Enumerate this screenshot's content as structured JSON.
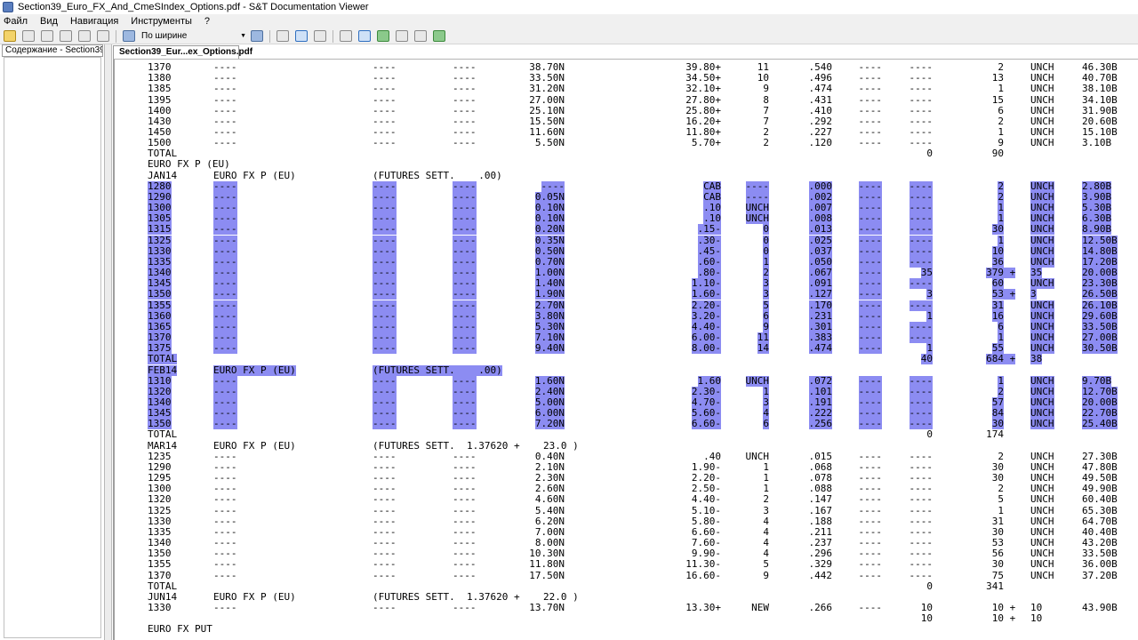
{
  "window": {
    "title": "Section39_Euro_FX_And_CmeSIndex_Options.pdf - S&T Documentation Viewer"
  },
  "menu": [
    "Файл",
    "Вид",
    "Навигация",
    "Инструменты",
    "?"
  ],
  "toolbar": {
    "zoom_value": "По ширине"
  },
  "left_panel": {
    "tab_label": "Содержание - Section39_Eu"
  },
  "document_tab": {
    "label": "Section39_Eur...ex_Options.pdf"
  },
  "table": {
    "rows": [
      [
        "1370",
        "----",
        "----",
        "----",
        "38.70N",
        "39.80+",
        "11",
        ".540",
        "----",
        "----",
        "2",
        "UNCH",
        "46.30B"
      ],
      [
        "1380",
        "----",
        "----",
        "----",
        "33.50N",
        "34.50+",
        "10",
        ".496",
        "----",
        "----",
        "13",
        "UNCH",
        "40.70B"
      ],
      [
        "1385",
        "----",
        "----",
        "----",
        "31.20N",
        "32.10+",
        "9",
        ".474",
        "----",
        "----",
        "1",
        "UNCH",
        "38.10B"
      ],
      [
        "1395",
        "----",
        "----",
        "----",
        "27.00N",
        "27.80+",
        "8",
        ".431",
        "----",
        "----",
        "15",
        "UNCH",
        "34.10B"
      ],
      [
        "1400",
        "----",
        "----",
        "----",
        "25.10N",
        "25.80+",
        "7",
        ".410",
        "----",
        "----",
        "6",
        "UNCH",
        "31.90B"
      ],
      [
        "1430",
        "----",
        "----",
        "----",
        "15.50N",
        "16.20+",
        "7",
        ".292",
        "----",
        "----",
        "2",
        "UNCH",
        "20.60B"
      ],
      [
        "1450",
        "----",
        "----",
        "----",
        "11.60N",
        "11.80+",
        "2",
        ".227",
        "----",
        "----",
        "1",
        "UNCH",
        "15.10B"
      ],
      [
        "1500",
        "----",
        "----",
        "----",
        "5.50N",
        "5.70+",
        "2",
        ".120",
        "----",
        "----",
        "9",
        "UNCH",
        "3.10B"
      ],
      [
        "TOTAL",
        "",
        "",
        "",
        "",
        "",
        "",
        "",
        "",
        "0",
        "90",
        "",
        ""
      ],
      [
        "EURO FX P (EU)",
        "",
        "",
        "",
        "",
        "",
        "",
        "",
        "",
        "",
        "",
        "",
        ""
      ],
      [
        "JAN14",
        "EURO FX P (EU)",
        "(FUTURES SETT.    .00)",
        "",
        "",
        "",
        "",
        "",
        "",
        "",
        "",
        "",
        ""
      ],
      [
        "1280",
        "----",
        "----",
        "----",
        "----",
        "CAB",
        "----",
        ".000",
        "----",
        "----",
        "2",
        "UNCH",
        "2.80B"
      ],
      [
        "1290",
        "----",
        "----",
        "----",
        "0.05N",
        "CAB",
        "----",
        ".002",
        "----",
        "----",
        "2",
        "UNCH",
        "3.90B"
      ],
      [
        "1300",
        "----",
        "----",
        "----",
        "0.10N",
        ".10",
        "UNCH",
        ".007",
        "----",
        "----",
        "1",
        "UNCH",
        "5.30B"
      ],
      [
        "1305",
        "----",
        "----",
        "----",
        "0.10N",
        ".10",
        "UNCH",
        ".008",
        "----",
        "----",
        "1",
        "UNCH",
        "6.30B"
      ],
      [
        "1315",
        "----",
        "----",
        "----",
        "0.20N",
        ".15-",
        "0",
        ".013",
        "----",
        "----",
        "30",
        "UNCH",
        "8.90B"
      ],
      [
        "1325",
        "----",
        "----",
        "----",
        "0.35N",
        ".30-",
        "0",
        ".025",
        "----",
        "----",
        "1",
        "UNCH",
        "12.50B"
      ],
      [
        "1330",
        "----",
        "----",
        "----",
        "0.50N",
        ".45-",
        "0",
        ".037",
        "----",
        "----",
        "10",
        "UNCH",
        "14.80B"
      ],
      [
        "1335",
        "----",
        "----",
        "----",
        "0.70N",
        ".60-",
        "1",
        ".050",
        "----",
        "----",
        "36",
        "UNCH",
        "17.20B"
      ],
      [
        "1340",
        "----",
        "----",
        "----",
        "1.00N",
        ".80-",
        "2",
        ".067",
        "----",
        "35",
        "379 +",
        "35",
        "20.00B"
      ],
      [
        "1345",
        "----",
        "----",
        "----",
        "1.40N",
        "1.10-",
        "3",
        ".091",
        "----",
        "----",
        "60",
        "UNCH",
        "23.30B"
      ],
      [
        "1350",
        "----",
        "----",
        "----",
        "1.90N",
        "1.60-",
        "3",
        ".127",
        "----",
        "3",
        "53 +",
        "3",
        "26.50B"
      ],
      [
        "1355",
        "----",
        "----",
        "----",
        "2.70N",
        "2.20-",
        "5",
        ".170",
        "----",
        "----",
        "31",
        "UNCH",
        "26.10B"
      ],
      [
        "1360",
        "----",
        "----",
        "----",
        "3.80N",
        "3.20-",
        "6",
        ".231",
        "----",
        "1",
        "16",
        "UNCH",
        "29.60B"
      ],
      [
        "1365",
        "----",
        "----",
        "----",
        "5.30N",
        "4.40-",
        "9",
        ".301",
        "----",
        "----",
        "6",
        "UNCH",
        "33.50B"
      ],
      [
        "1370",
        "----",
        "----",
        "----",
        "7.10N",
        "6.00-",
        "11",
        ".383",
        "----",
        "----",
        "1",
        "UNCH",
        "27.00B"
      ],
      [
        "1375",
        "----",
        "----",
        "----",
        "9.40N",
        "8.00-",
        "14",
        ".474",
        "----",
        "1",
        "55",
        "UNCH",
        "30.50B"
      ],
      [
        "TOTAL",
        "",
        "",
        "",
        "",
        "",
        "",
        "",
        "",
        "40",
        "684 +",
        "38",
        ""
      ],
      [
        "FEB14",
        "EURO FX P (EU)",
        "(FUTURES SETT.    .00)",
        "",
        "",
        "",
        "",
        "",
        "",
        "",
        "",
        "",
        ""
      ],
      [
        "1310",
        "----",
        "----",
        "----",
        "1.60N",
        "1.60",
        "UNCH",
        ".072",
        "----",
        "----",
        "1",
        "UNCH",
        "9.70B"
      ],
      [
        "1320",
        "----",
        "----",
        "----",
        "2.40N",
        "2.30-",
        "1",
        ".101",
        "----",
        "----",
        "2",
        "UNCH",
        "12.70B"
      ],
      [
        "1340",
        "----",
        "----",
        "----",
        "5.00N",
        "4.70-",
        "3",
        ".191",
        "----",
        "----",
        "57",
        "UNCH",
        "20.00B"
      ],
      [
        "1345",
        "----",
        "----",
        "----",
        "6.00N",
        "5.60-",
        "4",
        ".222",
        "----",
        "----",
        "84",
        "UNCH",
        "22.70B"
      ],
      [
        "1350",
        "----",
        "----",
        "----",
        "7.20N",
        "6.60-",
        "6",
        ".256",
        "----",
        "----",
        "30",
        "UNCH",
        "25.40B"
      ],
      [
        "TOTAL",
        "",
        "",
        "",
        "",
        "",
        "",
        "",
        "",
        "0",
        "174",
        "",
        ""
      ],
      [
        "MAR14",
        "EURO FX P (EU)",
        "(FUTURES SETT.  1.37620 +    23.0 )",
        "",
        "",
        "",
        "",
        "",
        "",
        "",
        "",
        "",
        ""
      ],
      [
        "1235",
        "----",
        "----",
        "----",
        "0.40N",
        ".40",
        "UNCH",
        ".015",
        "----",
        "----",
        "2",
        "UNCH",
        "27.30B"
      ],
      [
        "1290",
        "----",
        "----",
        "----",
        "2.10N",
        "1.90-",
        "1",
        ".068",
        "----",
        "----",
        "30",
        "UNCH",
        "47.80B"
      ],
      [
        "1295",
        "----",
        "----",
        "----",
        "2.30N",
        "2.20-",
        "1",
        ".078",
        "----",
        "----",
        "30",
        "UNCH",
        "49.50B"
      ],
      [
        "1300",
        "----",
        "----",
        "----",
        "2.60N",
        "2.50-",
        "1",
        ".088",
        "----",
        "----",
        "2",
        "UNCH",
        "49.90B"
      ],
      [
        "1320",
        "----",
        "----",
        "----",
        "4.60N",
        "4.40-",
        "2",
        ".147",
        "----",
        "----",
        "5",
        "UNCH",
        "60.40B"
      ],
      [
        "1325",
        "----",
        "----",
        "----",
        "5.40N",
        "5.10-",
        "3",
        ".167",
        "----",
        "----",
        "1",
        "UNCH",
        "65.30B"
      ],
      [
        "1330",
        "----",
        "----",
        "----",
        "6.20N",
        "5.80-",
        "4",
        ".188",
        "----",
        "----",
        "31",
        "UNCH",
        "64.70B"
      ],
      [
        "1335",
        "----",
        "----",
        "----",
        "7.00N",
        "6.60-",
        "4",
        ".211",
        "----",
        "----",
        "30",
        "UNCH",
        "40.40B"
      ],
      [
        "1340",
        "----",
        "----",
        "----",
        "8.00N",
        "7.60-",
        "4",
        ".237",
        "----",
        "----",
        "53",
        "UNCH",
        "43.20B"
      ],
      [
        "1350",
        "----",
        "----",
        "----",
        "10.30N",
        "9.90-",
        "4",
        ".296",
        "----",
        "----",
        "56",
        "UNCH",
        "33.50B"
      ],
      [
        "1355",
        "----",
        "----",
        "----",
        "11.80N",
        "11.30-",
        "5",
        ".329",
        "----",
        "----",
        "30",
        "UNCH",
        "36.00B"
      ],
      [
        "1370",
        "----",
        "----",
        "----",
        "17.50N",
        "16.60-",
        "9",
        ".442",
        "----",
        "----",
        "75",
        "UNCH",
        "37.20B"
      ],
      [
        "TOTAL",
        "",
        "",
        "",
        "",
        "",
        "",
        "",
        "",
        "0",
        "341",
        "",
        ""
      ],
      [
        "JUN14",
        "EURO FX P (EU)",
        "(FUTURES SETT.  1.37620 +    22.0 )",
        "",
        "",
        "",
        "",
        "",
        "",
        "",
        "",
        "",
        ""
      ],
      [
        "1330",
        "----",
        "----",
        "----",
        "13.70N",
        "13.30+",
        "NEW",
        ".266",
        "----",
        "10",
        "10 +",
        "10",
        "43.90B"
      ],
      [
        "",
        "",
        "",
        "",
        "",
        "",
        "",
        "",
        "",
        "10",
        "10 +",
        "10",
        ""
      ],
      [
        "EURO FX PUT",
        "",
        "",
        "",
        "",
        "",
        "",
        "",
        "",
        "",
        "",
        "",
        ""
      ]
    ]
  }
}
